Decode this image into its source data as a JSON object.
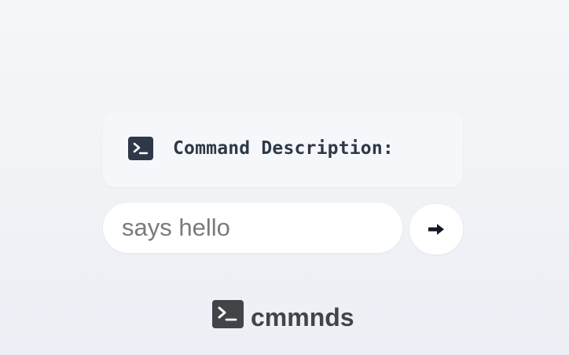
{
  "description_card": {
    "icon": "terminal-icon",
    "label": "Command Description:"
  },
  "command_input": {
    "value": "says hello",
    "placeholder": ""
  },
  "submit_button": {
    "icon": "arrow-right-icon",
    "glyph": "➡"
  },
  "brand": {
    "icon": "terminal-icon",
    "name": "cmmnds"
  },
  "colors": {
    "icon_dark": "#2f3848",
    "brand_text": "#414548",
    "input_text": "#7a7a7a"
  }
}
